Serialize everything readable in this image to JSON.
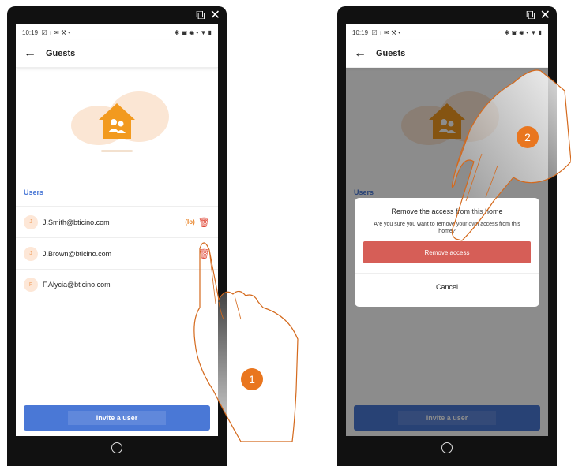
{
  "left": {
    "status_time": "10:19",
    "status_icons": "☑ ↑ ✉ ⚒ •",
    "status_right": "✱ ▣ ◉ • ▼ ▮",
    "back_icon": "←",
    "title": "Guests",
    "section_label": "Users",
    "users": [
      {
        "initial": "J",
        "email": "J.Smith@bticino.com",
        "badge": "(Io)"
      },
      {
        "initial": "J",
        "email": "J.Brown@bticino.com",
        "badge": ""
      },
      {
        "initial": "F",
        "email": "F.Alycia@bticino.com",
        "badge": ""
      }
    ],
    "invite_label": "Invite a user",
    "step": "1"
  },
  "right": {
    "status_time": "10:19",
    "status_icons": "☑ ↑ ✉ ⚒ •",
    "status_right": "✱ ▣ ◉ • ▼ ▮",
    "back_icon": "←",
    "title": "Guests",
    "section_label": "Users",
    "dialog": {
      "title": "Remove the access from this home",
      "message": "Are you sure you want to remove your own access from this home?",
      "remove_label": "Remove access",
      "cancel_label": "Cancel"
    },
    "invite_label": "Invite a user",
    "step": "2"
  },
  "chrome": {
    "external_icon": "⧉",
    "close_icon": "✕"
  },
  "colors": {
    "accent": "#4a78d6",
    "orange": "#e9761f",
    "danger": "#d65e57"
  }
}
